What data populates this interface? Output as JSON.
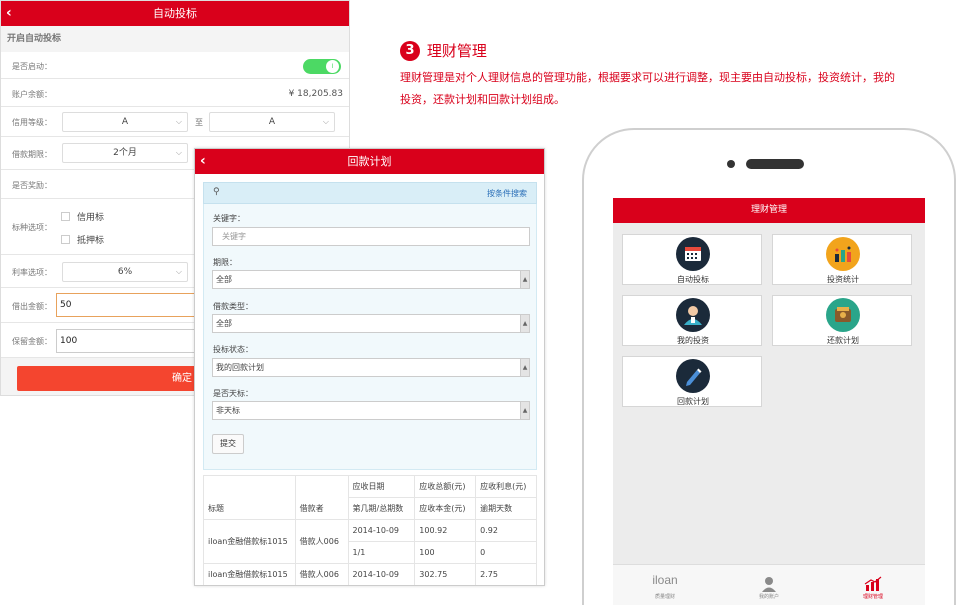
{
  "auto_bid": {
    "title": "自动投标",
    "section": "开启自动投标",
    "enabled_label": "是否启动：",
    "toggle_text": "I",
    "balance_label": "账户余额：",
    "balance_value": "¥ 18,205.83",
    "credit_label": "信用等级：",
    "credit_from": "A",
    "credit_to_sep": "至",
    "credit_to": "A",
    "term_label": "借款期限：",
    "term_from": "2个月",
    "reward_label": "是否奖励：",
    "type_label": "标种选项：",
    "type_options": [
      "信用标",
      "抵押标"
    ],
    "rate_label": "利率选项：",
    "rate_value": "6%",
    "lend_label": "借出金额：",
    "lend_value": "50",
    "reserve_label": "保留金额：",
    "reserve_value": "100",
    "confirm_label": "确定"
  },
  "repay_plan": {
    "title": "回款计划",
    "search_link": "按条件搜索",
    "keyword_label": "关键字：",
    "keyword_placeholder": "关键字",
    "period_label": "期限：",
    "period_value": "全部",
    "loan_type_label": "借款类型：",
    "loan_type_value": "全部",
    "bid_status_label": "投标状态：",
    "bid_status_value": "我的回款计划",
    "tianbiao_label": "是否天标：",
    "tianbiao_value": "非天标",
    "submit_label": "提交",
    "table": {
      "header_top": [
        "应收日期",
        "应收总额(元)",
        "应收利息(元)"
      ],
      "header_title": "标题",
      "header_borrower": "借款者",
      "header_bottom": [
        "第几期/总期数",
        "应收本金(元)",
        "逾期天数"
      ],
      "rows": [
        {
          "title": "iloan金融借款标1015",
          "borrower": "借款人006",
          "date": "2014-10-09",
          "total": "100.92",
          "interest": "0.92",
          "period": "1/1",
          "principal": "100",
          "overdue": "0"
        },
        {
          "title": "iloan金融借款标1015",
          "borrower": "借款人006",
          "date": "2014-10-09",
          "total": "302.75",
          "interest": "2.75"
        }
      ]
    }
  },
  "description": {
    "step": "3",
    "title": "理财管理",
    "body": "理财管理是对个人理财信息的管理功能，根据要求可以进行调整，现主要由自动投标，投资统计，我的投资，还款计划和回款计划组成。"
  },
  "phone": {
    "title": "理财管理",
    "tiles": [
      {
        "label": "自动投标",
        "icon": "calendar-icon",
        "color": "#1b2a3a"
      },
      {
        "label": "投资统计",
        "icon": "chart-icon",
        "color": "#f2a41c"
      },
      {
        "label": "我的投资",
        "icon": "person-icon",
        "color": "#1b2a3a"
      },
      {
        "label": "还款计划",
        "icon": "wallet-icon",
        "color": "#2aa58a"
      },
      {
        "label": "回款计划",
        "icon": "pencil-icon",
        "color": "#1b2a3a"
      }
    ],
    "tabs": [
      {
        "label": "质量理财",
        "logo": "iloan"
      },
      {
        "label": "我的账户"
      },
      {
        "label": "理财管理"
      }
    ],
    "active_color": "#d9001b"
  }
}
